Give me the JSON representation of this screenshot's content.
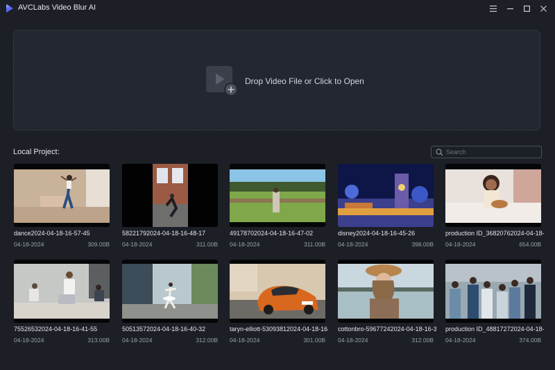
{
  "app": {
    "title": "AVCLabs Video Blur AI"
  },
  "window_controls": {
    "menu": "☰",
    "minimize": "—",
    "maximize": "☐",
    "close": "✕"
  },
  "dropzone": {
    "text": "Drop Video File or Click to Open"
  },
  "local_project": {
    "label": "Local Project:"
  },
  "search": {
    "placeholder": "Search"
  },
  "colors": {
    "background": "#1c1f26",
    "panel": "#23272f",
    "accent": "#5b6cff"
  },
  "projects": [
    {
      "name": "dance2024-04-18-16-57-45",
      "date": "04-18-2024",
      "size": "309.00B",
      "icon": "dance-thumbnail"
    },
    {
      "name": "58221792024-04-18-16-48-17",
      "date": "04-18-2024",
      "size": "311.00B",
      "icon": "street-thumbnail"
    },
    {
      "name": "49178702024-04-18-16-47-02",
      "date": "04-18-2024",
      "size": "311.00B",
      "icon": "field-thumbnail"
    },
    {
      "name": "disney2024-04-18-16-45-26",
      "date": "04-18-2024",
      "size": "398.00B",
      "icon": "castle-thumbnail"
    },
    {
      "name": "production ID_36820762024-04-18-1",
      "date": "04-18-2024",
      "size": "654.00B",
      "icon": "girl-ukulele-thumbnail"
    },
    {
      "name": "75526532024-04-18-16-41-55",
      "date": "04-18-2024",
      "size": "313.00B",
      "icon": "office-thumbnail"
    },
    {
      "name": "50513572024-04-18-16-40-32",
      "date": "04-18-2024",
      "size": "312.00B",
      "icon": "ballet-thumbnail"
    },
    {
      "name": "taryn-elliott-53093812024-04-18-16-",
      "date": "04-18-2024",
      "size": "301.00B",
      "icon": "car-thumbnail"
    },
    {
      "name": "cottonbro-59677242024-04-18-16-3",
      "date": "04-18-2024",
      "size": "312.00B",
      "icon": "hat-woman-thumbnail"
    },
    {
      "name": "production ID_48817272024-04-18-1",
      "date": "04-18-2024",
      "size": "374.00B",
      "icon": "group-thumbnail"
    }
  ]
}
